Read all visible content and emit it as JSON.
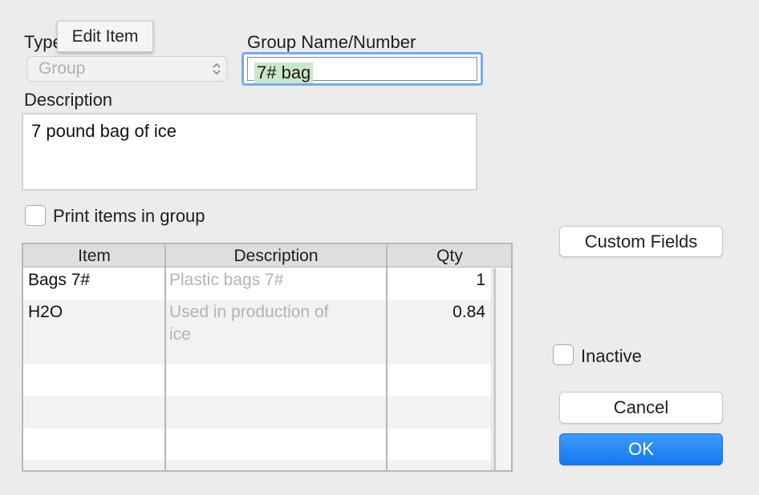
{
  "tooltip": {
    "text": "Edit Item"
  },
  "type_field": {
    "label": "Type",
    "value": "Group"
  },
  "group_name": {
    "label": "Group Name/Number",
    "value": "7# bag"
  },
  "description": {
    "label": "Description",
    "value": "7 pound bag of ice"
  },
  "print_items": {
    "label": "Print items in group",
    "checked": false
  },
  "table": {
    "headers": [
      "Item",
      "Description",
      "Qty"
    ],
    "rows": [
      {
        "item": "Bags 7#",
        "description": "Plastic bags 7#",
        "qty": "1"
      },
      {
        "item": "H2O",
        "description": "Used in production of ice",
        "qty": "0.84"
      }
    ]
  },
  "buttons": {
    "custom_fields": "Custom Fields",
    "cancel": "Cancel",
    "ok": "OK"
  },
  "inactive": {
    "label": "Inactive",
    "checked": false
  },
  "colors": {
    "accent": "#1678f0",
    "focus_ring": "#7aa8ee",
    "selection": "#cbe7c9"
  }
}
